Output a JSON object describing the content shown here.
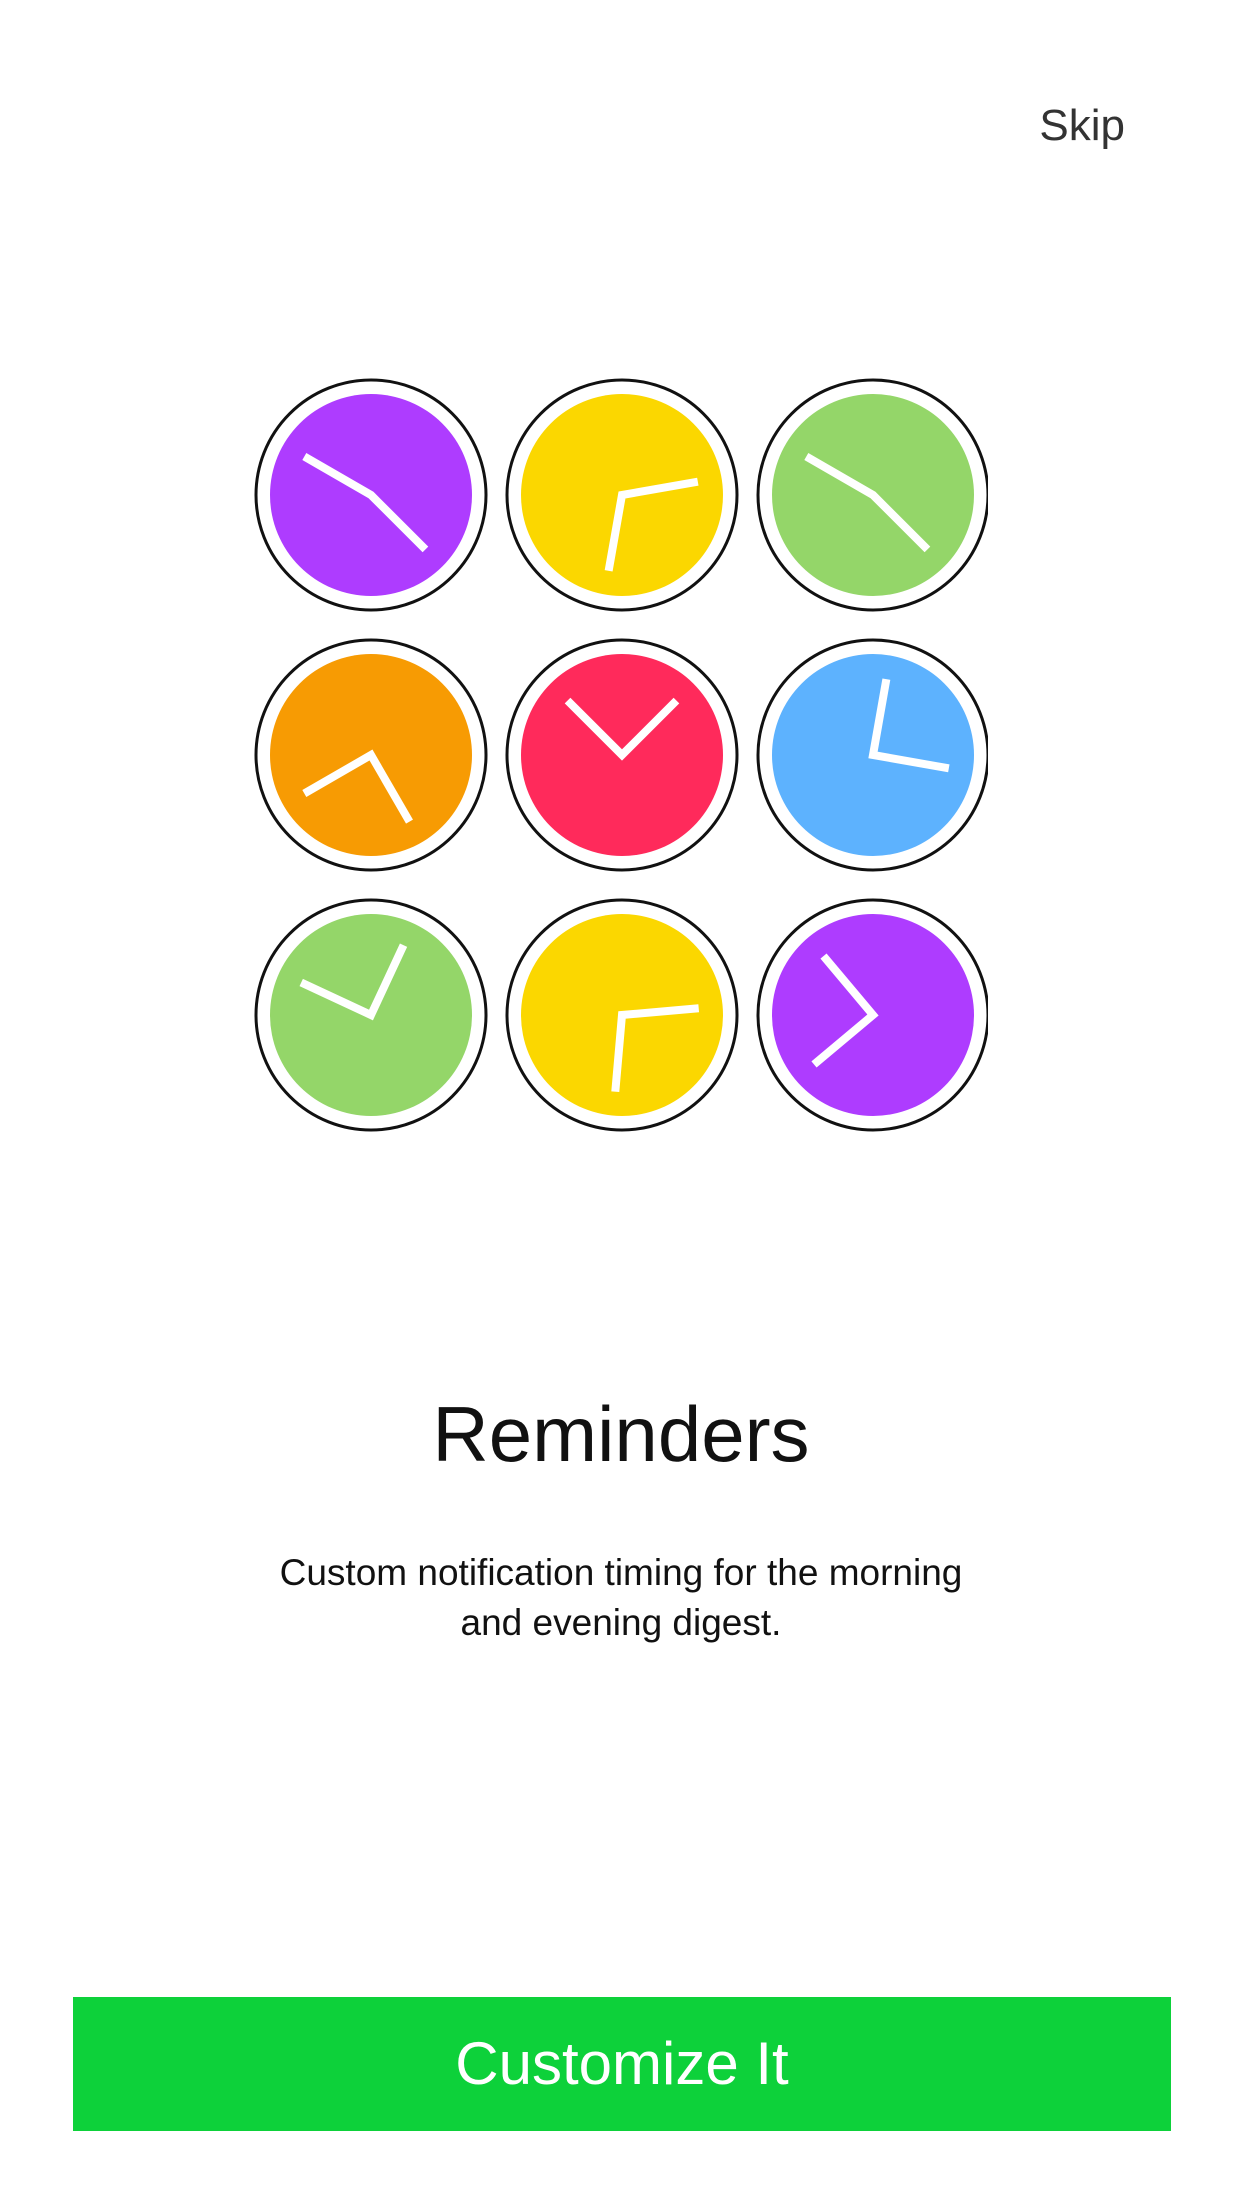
{
  "header": {
    "skip_label": "Skip"
  },
  "onboarding": {
    "title": "Reminders",
    "description": "Custom notification timing for the morning and evening digest."
  },
  "cta": {
    "label": "Customize It",
    "color": "#0dd13a"
  },
  "clocks": [
    {
      "color": "#ae3cff",
      "hour_hand": 300,
      "minute_hand": 135,
      "icon": "clock-icon"
    },
    {
      "color": "#fbd700",
      "hour_hand": 80,
      "minute_hand": 190,
      "icon": "clock-icon"
    },
    {
      "color": "#94d669",
      "hour_hand": 300,
      "minute_hand": 135,
      "icon": "clock-icon"
    },
    {
      "color": "#f79b03",
      "hour_hand": 240,
      "minute_hand": 150,
      "icon": "clock-icon"
    },
    {
      "color": "#ff2a5b",
      "hour_hand": 315,
      "minute_hand": 45,
      "icon": "clock-icon"
    },
    {
      "color": "#5db2fe",
      "hour_hand": 10,
      "minute_hand": 100,
      "icon": "clock-icon"
    },
    {
      "color": "#94d669",
      "hour_hand": 295,
      "minute_hand": 25,
      "icon": "clock-icon"
    },
    {
      "color": "#fbd700",
      "hour_hand": 85,
      "minute_hand": 185,
      "icon": "clock-icon"
    },
    {
      "color": "#ae3cff",
      "hour_hand": 320,
      "minute_hand": 230,
      "icon": "clock-icon"
    }
  ]
}
